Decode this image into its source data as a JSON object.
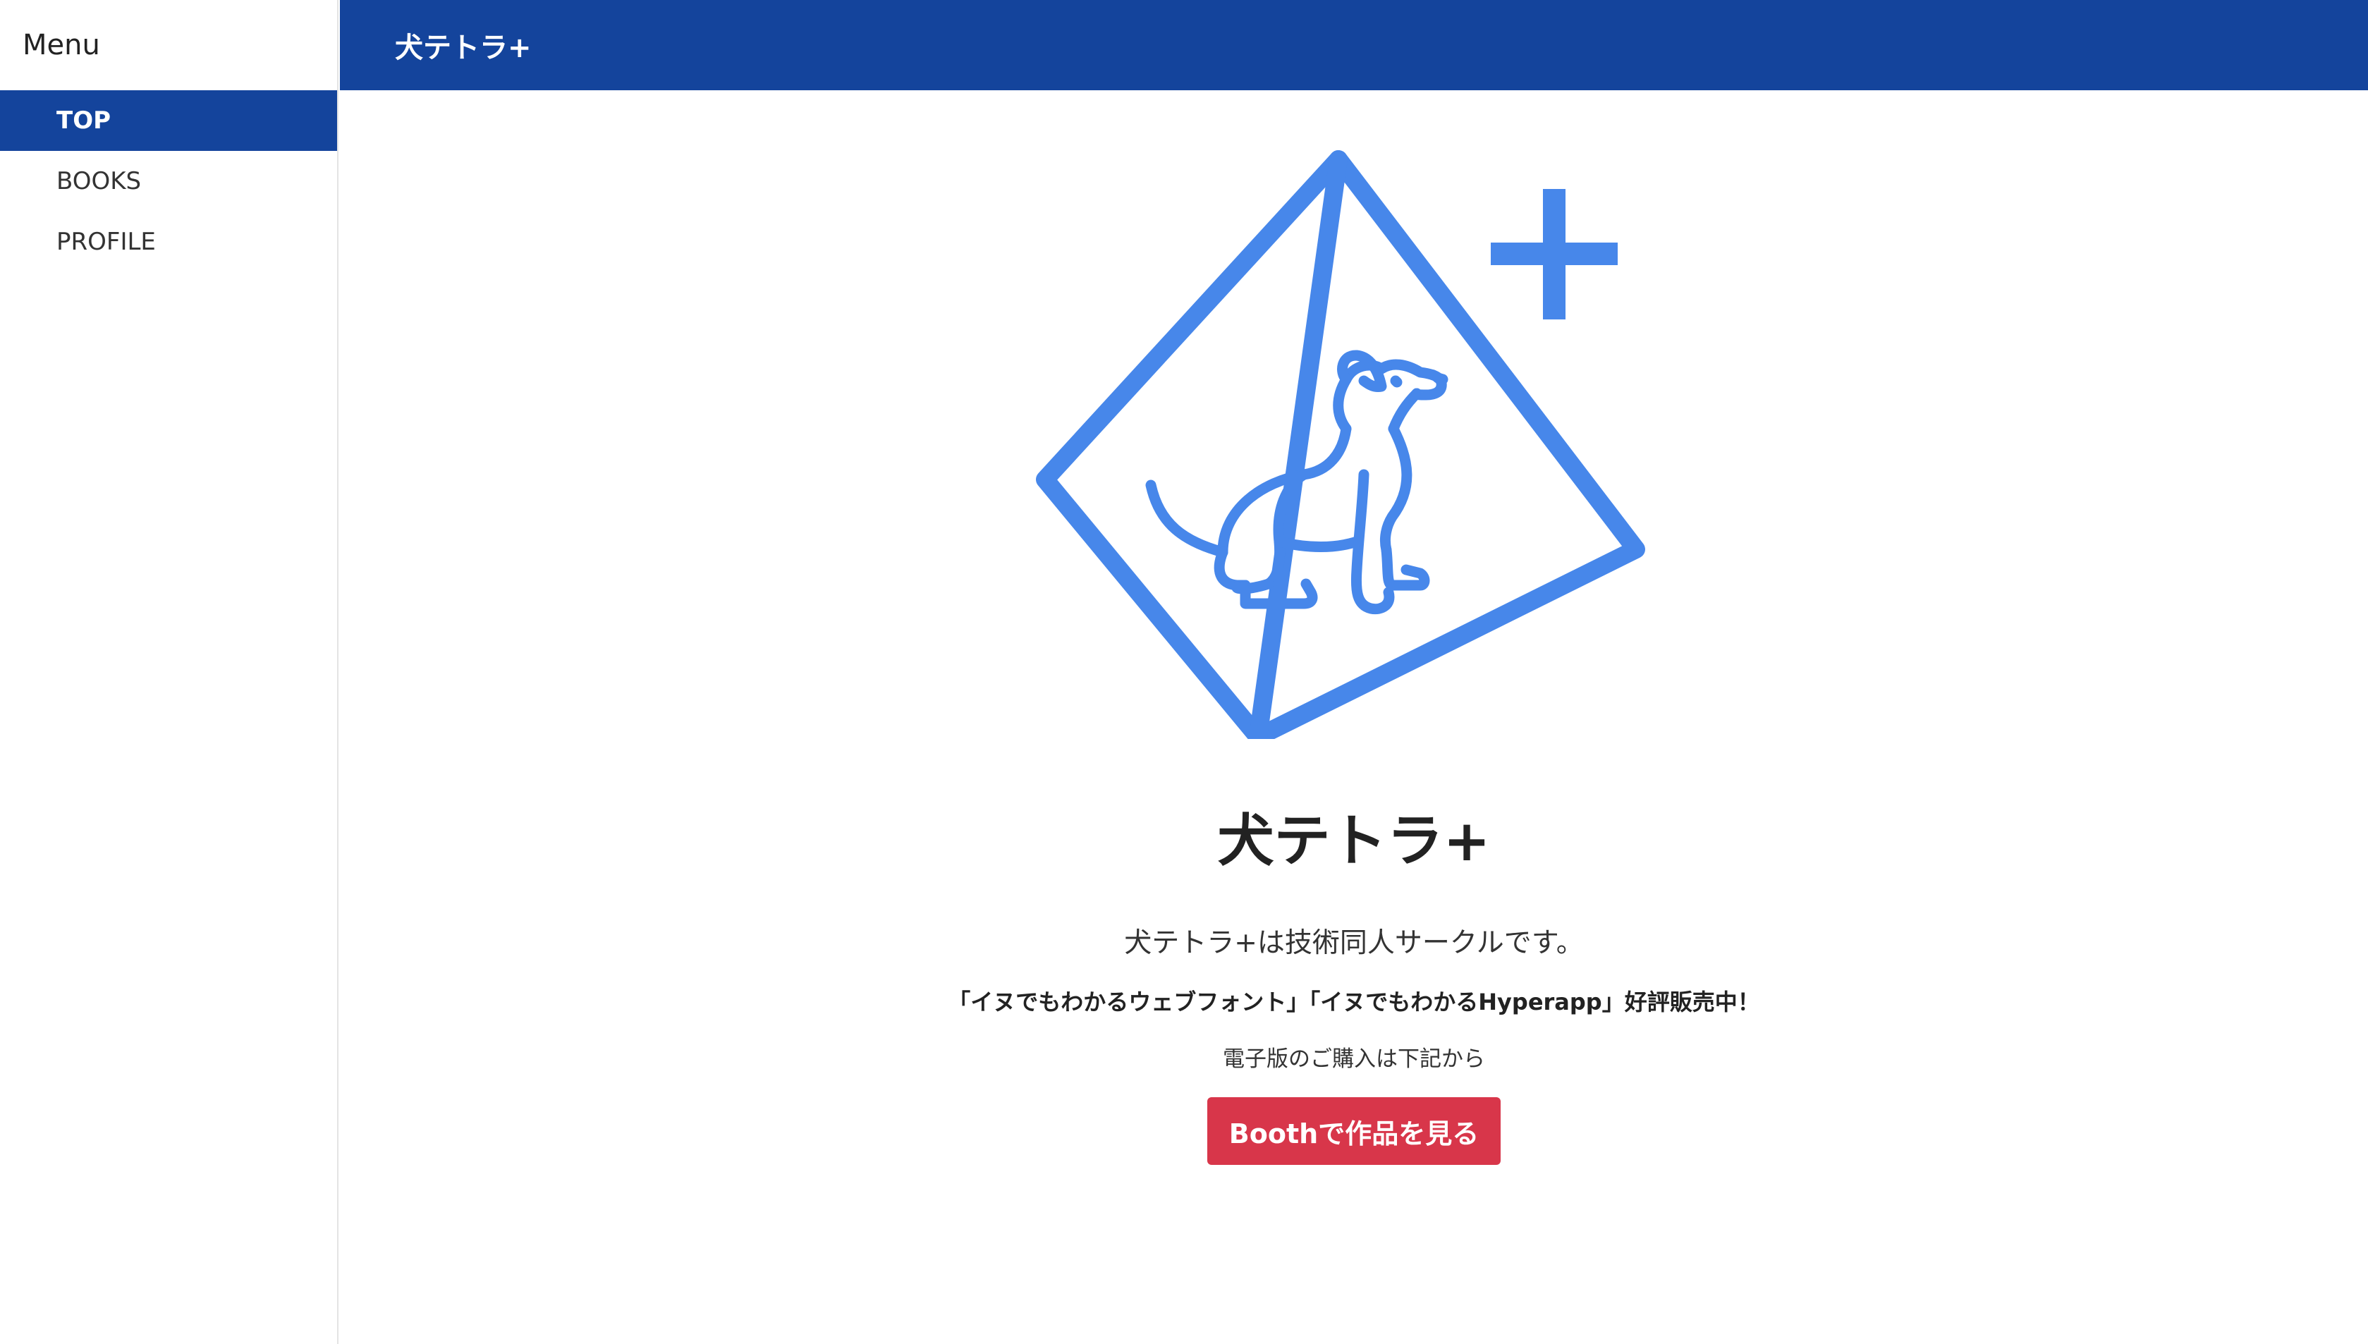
{
  "sidebar": {
    "header": "Menu",
    "items": [
      {
        "label": "TOP",
        "active": true
      },
      {
        "label": "BOOKS",
        "active": false
      },
      {
        "label": "PROFILE",
        "active": false
      }
    ]
  },
  "appbar": {
    "title": "犬テトラ+"
  },
  "hero": {
    "logo_icon": "dog-tetrahedron-logo-icon",
    "title": "犬テトラ+",
    "description": "犬テトラ+は技術同人サークルです。",
    "promo": "「イヌでもわかるウェブフォント」「イヌでもわかるHyperapp」好評販売中！",
    "note": "電子版のご購入は下記から",
    "button_label": "Boothで作品を見る"
  },
  "colors": {
    "primary": "#14449c",
    "logo_blue": "#4787ea",
    "button_red": "#d8364a"
  }
}
